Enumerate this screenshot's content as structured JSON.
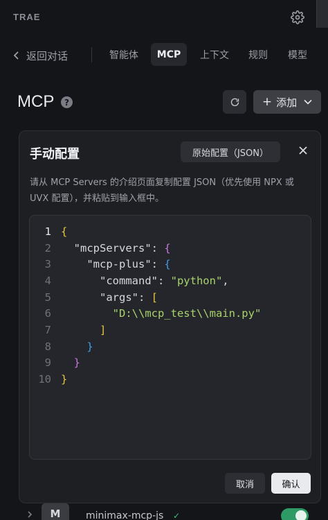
{
  "app": {
    "name": "TRAE"
  },
  "nav": {
    "back_label": "返回对话",
    "tabs": [
      {
        "label": "智能体",
        "active": false
      },
      {
        "label": "MCP",
        "active": true
      },
      {
        "label": "上下文",
        "active": false
      },
      {
        "label": "规则",
        "active": false
      },
      {
        "label": "模型",
        "active": false
      }
    ]
  },
  "header": {
    "title": "MCP",
    "help": "?",
    "add_label": "添加"
  },
  "modal": {
    "title": "手动配置",
    "raw_config_label": "原始配置（JSON）",
    "description": "请从 MCP Servers 的介绍页面复制配置 JSON（优先使用 NPX 或 UVX 配置），并粘贴到输入框中。",
    "code_lines": [
      "{",
      "  \"mcpServers\": {",
      "    \"mcp-plus\": {",
      "      \"command\": \"python\",",
      "      \"args\": [",
      "        \"D:\\\\mcp_test\\\\main.py\"",
      "      ]",
      "    }",
      "  }",
      "}"
    ],
    "line_numbers": [
      "1",
      "2",
      "3",
      "4",
      "5",
      "6",
      "7",
      "8",
      "9",
      "10"
    ],
    "cancel_label": "取消",
    "confirm_label": "确认"
  },
  "server_list": [
    {
      "avatar": "M",
      "name": "minimax-mcp-js",
      "status": "✓",
      "enabled": true
    }
  ],
  "colors": {
    "background": "#141519",
    "modal": "#1e1f23",
    "editor": "#25262b",
    "brace_yellow": "#e8c341",
    "brace_purple": "#c678dd",
    "brace_blue": "#3d9ee6",
    "string_green": "#a8d36b",
    "toggle_on": "#2e9a66"
  }
}
